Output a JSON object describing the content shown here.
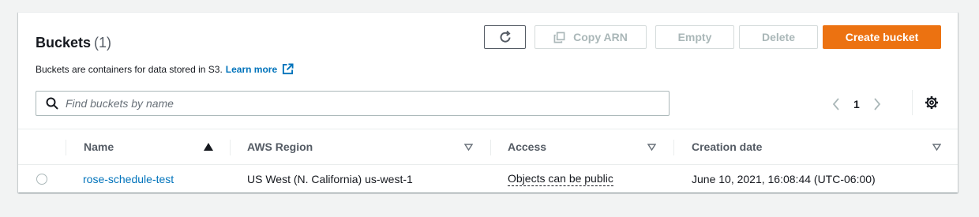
{
  "header": {
    "title": "Buckets",
    "count": "(1)",
    "description": "Buckets are containers for data stored in S3.",
    "learn_more": "Learn more"
  },
  "toolbar": {
    "copy_arn_label": "Copy ARN",
    "empty_label": "Empty",
    "delete_label": "Delete",
    "create_label": "Create bucket"
  },
  "search": {
    "placeholder": "Find buckets by name",
    "value": ""
  },
  "pagination": {
    "current_page": "1"
  },
  "table": {
    "columns": [
      "Name",
      "AWS Region",
      "Access",
      "Creation date"
    ],
    "rows": [
      {
        "name": "rose-schedule-test",
        "region": "US West (N. California) us-west-1",
        "access": "Objects can be public",
        "created": "June 10, 2021, 16:08:44 (UTC-06:00)"
      }
    ]
  },
  "colors": {
    "accent": "#ec7211",
    "link": "#0073bb",
    "background": "#f2f3f3"
  },
  "icons": [
    "refresh-icon",
    "copy-icon",
    "external-link-icon",
    "search-icon",
    "chevron-left-icon",
    "chevron-right-icon",
    "settings-gear-icon",
    "sort-ascending-icon",
    "sort-caret-icon"
  ]
}
